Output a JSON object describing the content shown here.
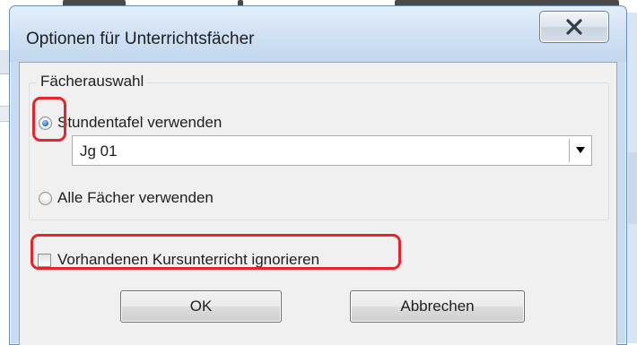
{
  "dialog": {
    "title": "Optionen für Unterrichtsfächer",
    "close_icon": "close-x-icon"
  },
  "group": {
    "legend": "Fächerauswahl",
    "option_timetable_label": "Stundentafel verwenden",
    "option_timetable_selected": true,
    "timetable_select_value": "Jg 01",
    "option_all_label": "Alle Fächer verwenden",
    "option_all_selected": false
  },
  "ignore_course": {
    "label": "Vorhandenen Kursunterricht ignorieren",
    "checked": false
  },
  "buttons": {
    "ok_label": "OK",
    "cancel_label": "Abbrechen"
  },
  "colors": {
    "highlight": "#e8232b",
    "dialog_frame": "#c7dcf1",
    "client_bg": "#f0f0f0"
  }
}
